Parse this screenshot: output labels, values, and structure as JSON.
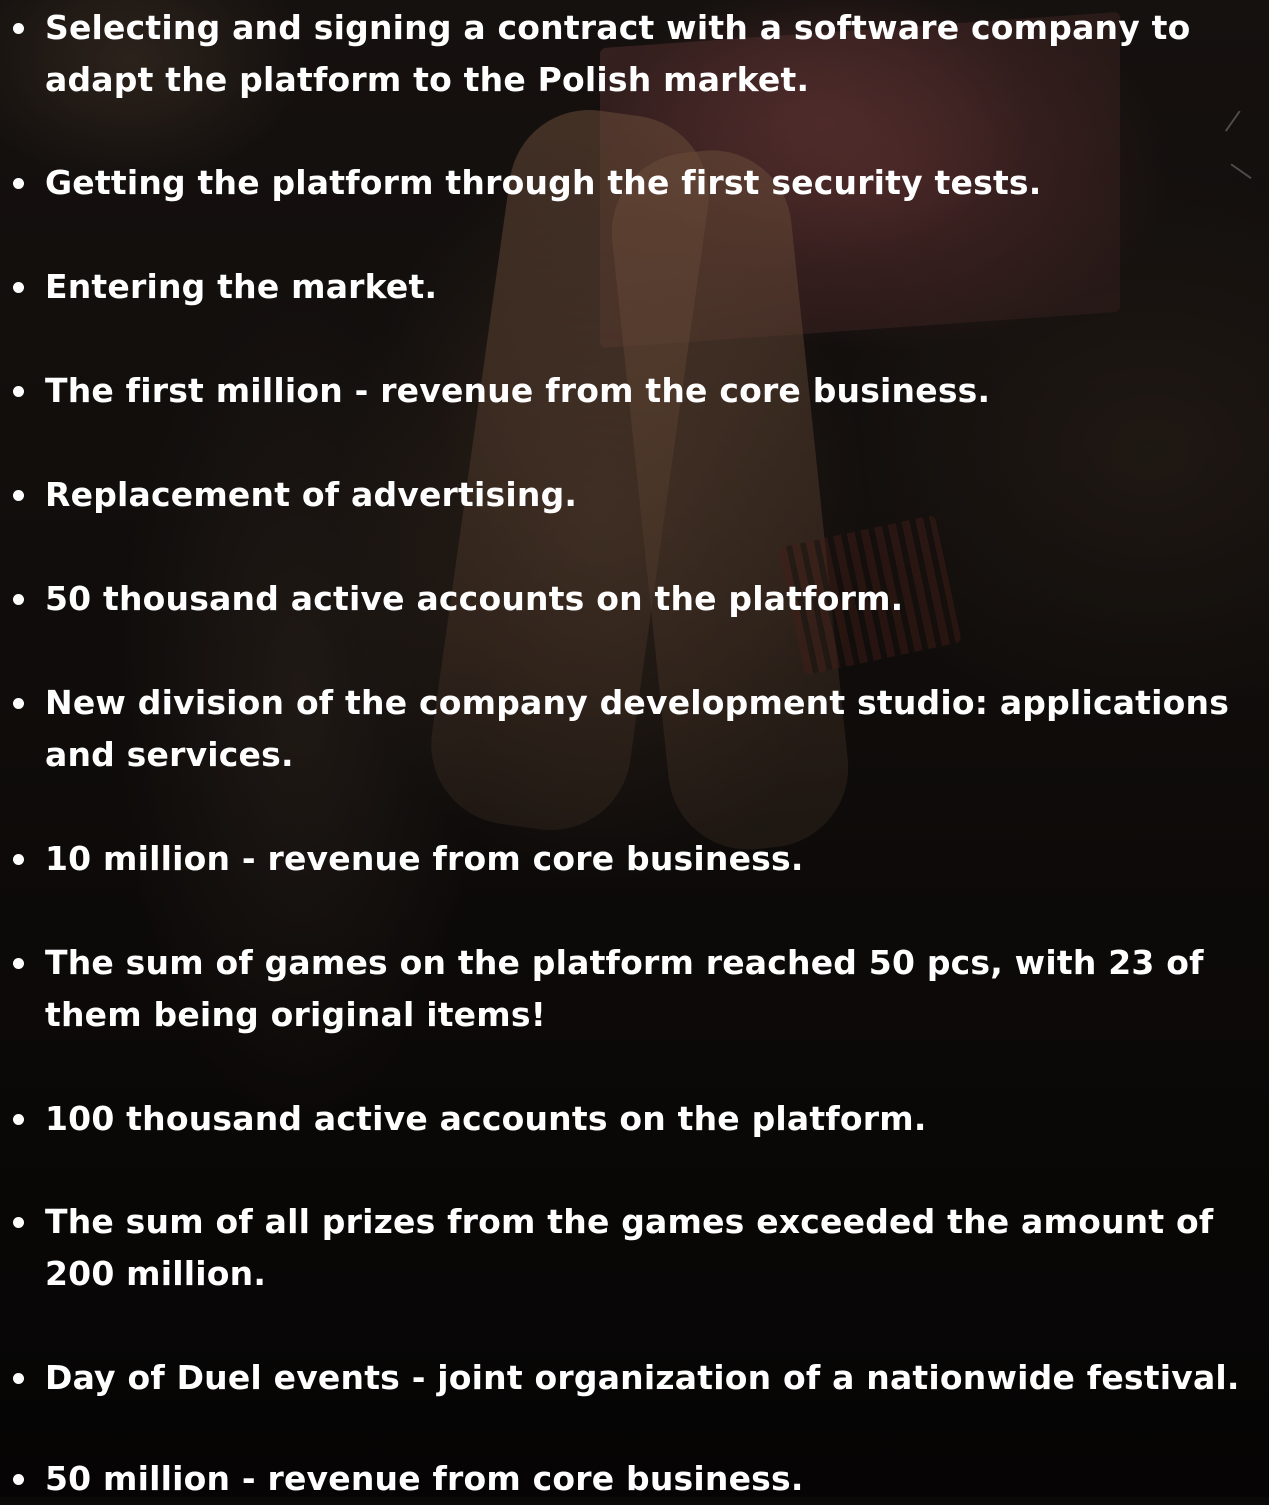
{
  "milestones": [
    {
      "lines": [
        "Selecting and signing a contract with a software company to",
        "adapt the platform to the Polish market."
      ]
    },
    {
      "lines": [
        "Getting the platform through the first security tests."
      ]
    },
    {
      "lines": [
        "Entering the market."
      ]
    },
    {
      "lines": [
        "The first million - revenue from the core business."
      ]
    },
    {
      "lines": [
        "Replacement of advertising."
      ]
    },
    {
      "lines": [
        "50 thousand active accounts on the platform."
      ]
    },
    {
      "lines": [
        "New division of the company development studio: applications",
        "and services."
      ]
    },
    {
      "lines": [
        "10 million - revenue from core business."
      ]
    },
    {
      "lines": [
        "The sum of games on the platform reached 50 pcs, with 23 of",
        "them being original items!"
      ]
    },
    {
      "lines": [
        "100 thousand active accounts on the platform."
      ]
    },
    {
      "lines": [
        "The sum of all prizes from the games exceeded the amount of",
        "200 million."
      ]
    },
    {
      "lines": [
        "Day of Duel events - joint organization of a nationwide festival."
      ]
    },
    {
      "lines": [
        "50 million - revenue from core business."
      ]
    }
  ]
}
